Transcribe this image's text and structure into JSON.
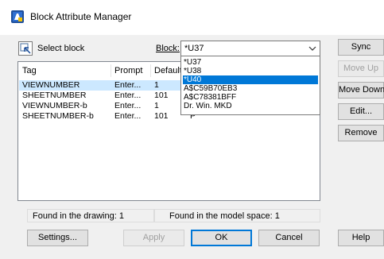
{
  "window": {
    "title": "Block Attribute Manager",
    "icon": "block-attribute-manager-icon"
  },
  "toolbar": {
    "select_block_label": "Select block",
    "block_label": "Block:",
    "block_value": "*U37"
  },
  "block_dropdown": {
    "options": [
      "*U37",
      "*U38",
      "*U40",
      "A$C59B70EB3",
      "A$C78381BFF",
      "Dr. Win. MKD"
    ],
    "selected_index": 2
  },
  "table": {
    "headers": [
      "Tag",
      "Prompt",
      "Default"
    ],
    "rows": [
      {
        "tag": "VIEWNUMBER",
        "prompt": "Enter...",
        "default": "1",
        "extra": ""
      },
      {
        "tag": "SHEETNUMBER",
        "prompt": "Enter...",
        "default": "101",
        "extra": ""
      },
      {
        "tag": "VIEWNUMBER-b",
        "prompt": "Enter...",
        "default": "1",
        "extra": ""
      },
      {
        "tag": "SHEETNUMBER-b",
        "prompt": "Enter...",
        "default": "101",
        "extra": "P"
      }
    ]
  },
  "side_buttons": {
    "sync": "Sync",
    "move_up": "Move Up",
    "move_down": "Move Down",
    "edit": "Edit...",
    "remove": "Remove"
  },
  "status": {
    "found_drawing": "Found in the drawing: 1",
    "found_model": "Found in the model space: 1"
  },
  "bottom_buttons": {
    "settings": "Settings...",
    "apply": "Apply",
    "ok": "OK",
    "cancel": "Cancel",
    "help": "Help"
  },
  "colors": {
    "selection": "#0078d7",
    "row_selection": "#cce8ff",
    "dialog_bg": "#f0f0f0"
  }
}
